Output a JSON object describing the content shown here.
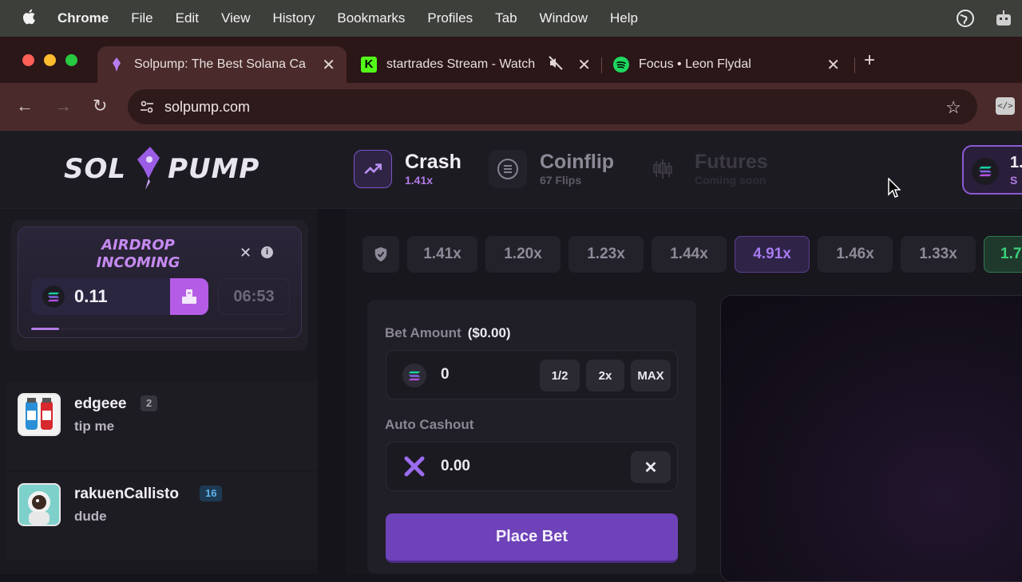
{
  "menubar": {
    "items": [
      "Chrome",
      "File",
      "Edit",
      "View",
      "History",
      "Bookmarks",
      "Profiles",
      "Tab",
      "Window",
      "Help"
    ]
  },
  "browser": {
    "tabs": [
      {
        "title": "Solpump: The Best Solana Ca",
        "active": true
      },
      {
        "title": "startrades Stream - Watch",
        "muted": true
      },
      {
        "title": "Focus • Leon Flydal"
      }
    ],
    "url": "solpump.com"
  },
  "site": {
    "logo_left": "SOL",
    "logo_right": "PUMP",
    "games": [
      {
        "name": "Crash",
        "sub": "1.41x"
      },
      {
        "name": "Coinflip",
        "sub": "67 Flips"
      },
      {
        "name": "Futures",
        "sub": "Coming soon"
      }
    ],
    "balance_partial": "1.",
    "balance_sub_partial": "S"
  },
  "airdrop": {
    "title": "AIRDROP INCOMING",
    "amount": "0.11",
    "timer": "06:53",
    "progress_fraction": 0.11
  },
  "chat": [
    {
      "username": "edgeee",
      "level": "2",
      "message": "tip me"
    },
    {
      "username": "rakuenCallisto",
      "level": "16",
      "message": "dude"
    }
  ],
  "history": [
    "1.41x",
    "1.20x",
    "1.23x",
    "1.44x",
    "4.91x",
    "1.46x",
    "1.33x",
    "1.7"
  ],
  "bet": {
    "amount_label": "Bet Amount",
    "amount_usd": "($0.00)",
    "amount_value": "0",
    "half_label": "1/2",
    "double_label": "2x",
    "max_label": "MAX",
    "cashout_label": "Auto Cashout",
    "cashout_value": "0.00",
    "place_label": "Place Bet"
  },
  "colors": {
    "accent_purple": "#6e42b8",
    "highlight_multiplier": "#a67af0",
    "green_multiplier": "#3bd17a"
  }
}
